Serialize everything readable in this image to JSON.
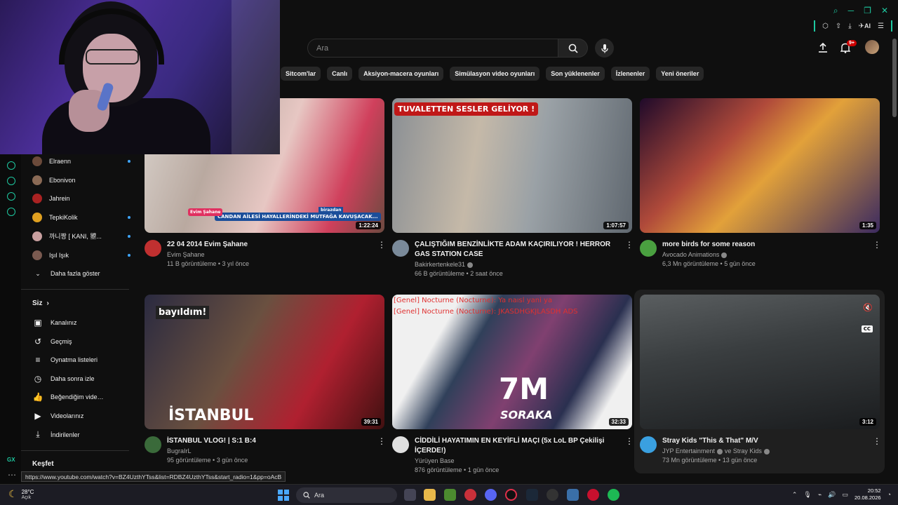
{
  "window": {
    "icons": [
      "search-icon",
      "minimize-icon",
      "restore-icon",
      "close-icon"
    ],
    "ai_label": "AI"
  },
  "header": {
    "search_placeholder": "Ara",
    "notifications_badge": "9+"
  },
  "chips": [
    "Sitcom'lar",
    "Canlı",
    "Aksiyon-macera oyunları",
    "Simülasyon video oyunları",
    "Son yüklenenler",
    "İzlenenler",
    "Yeni öneriler"
  ],
  "sidebar": {
    "subscriptions": [
      {
        "label": "Elraenn",
        "dot": true,
        "color": "#6b4a3a"
      },
      {
        "label": "Ebonivon",
        "dot": false,
        "color": "#8a6a55"
      },
      {
        "label": "Jahrein",
        "dot": false,
        "color": "#aa2222"
      },
      {
        "label": "TepkiKolik",
        "dot": true,
        "color": "#e0a020"
      },
      {
        "label": "까니짱 [ KANI, 曌...",
        "dot": true,
        "color": "#c9a0a0"
      },
      {
        "label": "Işıl Işık",
        "dot": true,
        "color": "#7a5a50"
      }
    ],
    "show_more": "Daha fazla göster",
    "you_heading": "Siz",
    "you_items": [
      {
        "label": "Kanalınız",
        "icon": "channel-icon"
      },
      {
        "label": "Geçmiş",
        "icon": "history-icon"
      },
      {
        "label": "Oynatma listeleri",
        "icon": "playlist-icon"
      },
      {
        "label": "Daha sonra izle",
        "icon": "clock-icon"
      },
      {
        "label": "Beğendiğim videolar",
        "icon": "like-icon"
      },
      {
        "label": "Videolarınız",
        "icon": "video-icon"
      },
      {
        "label": "İndirilenler",
        "icon": "download-icon"
      }
    ],
    "explore_heading": "Keşfet",
    "gx_label": "GX"
  },
  "videos": [
    {
      "title": "22 04 2014   Evim Şahane",
      "channel": "Evim Şahane",
      "verified": false,
      "stats": "11 B görüntüleme • 3 yıl önce",
      "duration": "1:22:24",
      "thumb_text": [
        "Evim Şahane",
        "CANDAN AİLESİ HAYALLERİNDEKİ MUTFAĞA KAVUŞACAK...",
        "birazdan"
      ]
    },
    {
      "title": "ÇALIŞTIĞIM BENZİNLİKTE ADAM KAÇIRILIYOR ! HERROR GAS STATION CASE",
      "channel": "Bakirkertenkele31",
      "verified": true,
      "stats": "66 B görüntüleme • 2 saat önce",
      "duration": "1:07:57",
      "thumb_text": [
        "TUVALETTEN SESLER GELİYOR !"
      ]
    },
    {
      "title": "more birds for some reason",
      "channel": "Avocado Animations",
      "verified": true,
      "stats": "6,3 Mn görüntüleme • 5 gün önce",
      "duration": "1:35",
      "thumb_text": []
    },
    {
      "title": "İSTANBUL VLOG! | S:1 B:4",
      "channel": "BugraIrL",
      "verified": false,
      "stats": "95 görüntüleme • 3 gün önce",
      "duration": "39:31",
      "thumb_text": [
        "bayıldım!",
        "İSTANBUL"
      ]
    },
    {
      "title": "CİDDİLİ HAYATIMIN EN KEYİFLİ MAÇI (5x LoL BP Çekilişi İÇERDE!)",
      "channel": "Yürüyen Base",
      "verified": false,
      "stats": "876 görüntüleme • 1 gün önce",
      "duration": "32:33",
      "thumb_text": [
        "[Genel] Nocturne (Nocturne): Ya naısl yani ya",
        "[Genel] Nocturne (Nocturne): JKASDHGKJLASDH ADS",
        "7M",
        "SORAKA"
      ]
    },
    {
      "title": "Stray Kids \"This & That\" M/V",
      "channel": "JYP Entertainment",
      "channel_extra": "ve Stray Kids",
      "verified": true,
      "stats": "73 Mn görüntüleme • 13 gün önce",
      "duration": "3:12",
      "thumb_text": [
        "CC"
      ]
    }
  ],
  "status_url": "https://www.youtube.com/watch?v=BZ4UzthYTss&list=RDBZ4UzthYTss&start_radio=1&pp=oAcB",
  "taskbar": {
    "temp": "28°C",
    "condition": "Açık",
    "search_label": "Ara",
    "time": "20:52",
    "date": "20.08.2026"
  }
}
